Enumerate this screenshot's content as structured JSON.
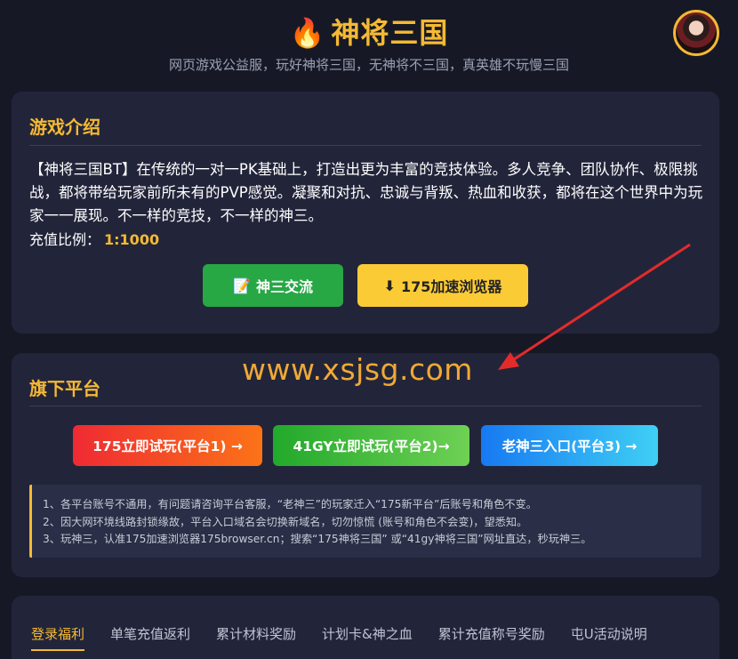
{
  "header": {
    "title": "神将三国",
    "flame_icon": "🔥",
    "subtitle": "网页游戏公益服，玩好神将三国，无神将不三国，真英雄不玩慢三国"
  },
  "intro_card": {
    "title": "游戏介绍",
    "text": "【神将三国BT】在传统的一对一PK基础上，打造出更为丰富的竞技体验。多人竞争、团队协作、极限挑战，都将带给玩家前所未有的PVP感觉。凝聚和对抗、忠诚与背叛、热血和收获，都将在这个世界中为玩家一一展现。不一样的竞技，不一样的神三。",
    "ratio_label": "充值比例：",
    "ratio_value": "1:1000",
    "buttons": {
      "community": {
        "icon": "📝",
        "label": "神三交流"
      },
      "browser": {
        "icon": "⬇",
        "label": "175加速浏览器"
      }
    }
  },
  "watermark": "www.xsjsg.com",
  "platform_card": {
    "title": "旗下平台",
    "platforms": [
      {
        "label": "175立即试玩(平台1) →"
      },
      {
        "label": "41GY立即试玩(平台2)→"
      },
      {
        "label": "老神三入口(平台3) →"
      }
    ],
    "notes": [
      "1、各平台账号不通用，有问题请咨询平台客服，“老神三”的玩家迁入“175新平台”后账号和角色不变。",
      "2、因大网环境线路封锁缘故，平台入口域名会切换新域名，切勿惊慌 (账号和角色不会变)，望悉知。",
      "3、玩神三，认准175加速浏览器175browser.cn；搜索“175神将三国” 或“41gy神将三国”网址直达，秒玩神三。"
    ]
  },
  "tabs": [
    {
      "label": "登录福利",
      "active": true
    },
    {
      "label": "单笔充值返利"
    },
    {
      "label": "累计材料奖励"
    },
    {
      "label": "计划卡&神之血"
    },
    {
      "label": "累计充值称号奖励"
    },
    {
      "label": "屯U活动说明"
    }
  ],
  "colors": {
    "accent": "#f5b933",
    "background": "#161925",
    "card": "#22253a"
  }
}
